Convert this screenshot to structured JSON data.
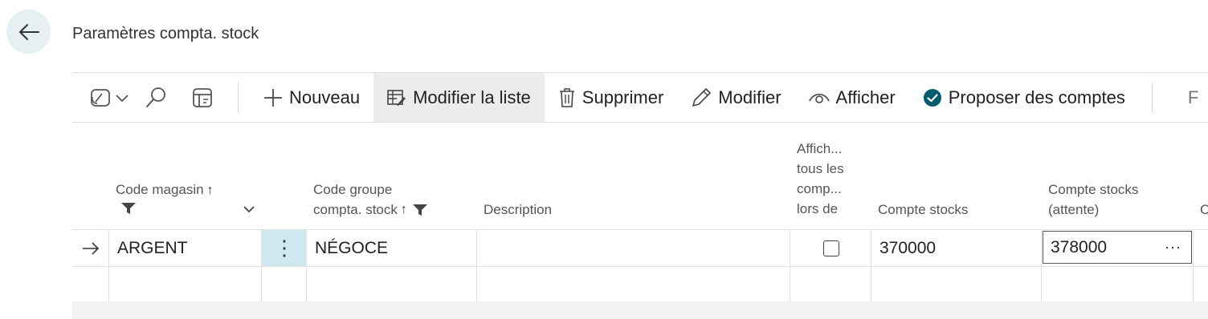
{
  "page": {
    "title": "Paramètres compta. stock"
  },
  "actions": {
    "nouveau": "Nouveau",
    "modifier_liste": "Modifier la liste",
    "supprimer": "Supprimer",
    "modifier": "Modifier",
    "afficher": "Afficher",
    "proposer": "Proposer des comptes"
  },
  "columns": {
    "code_magasin": "Code magasin",
    "code_groupe_line1": "Code groupe",
    "code_groupe_line2": "compta. stock",
    "description": "Description",
    "afficher_line1": "Affich...",
    "afficher_line2": "tous les",
    "afficher_line3": "comp...",
    "afficher_line4": "lors de",
    "compte_stocks": "Compte stocks",
    "compte_attente_line1": "Compte stocks",
    "compte_attente_line2": "(attente)",
    "next_partial": "C"
  },
  "rows": [
    {
      "code_magasin": "ARGENT",
      "code_groupe": "NÉGOCE",
      "description": "",
      "afficher_tous": false,
      "compte_stocks": "370000",
      "compte_attente": "378000"
    }
  ],
  "icons": {
    "back": "arrow-left-icon",
    "copilot": "copilot-icon",
    "search": "search-icon",
    "layout": "layout-icon",
    "add": "plus-icon",
    "edit_list": "edit-list-icon",
    "delete": "trash-icon",
    "edit": "pencil-icon",
    "view": "eye-icon",
    "suggest": "check-circle-icon",
    "sort": "sort-ascending-icon",
    "filter": "filter-icon"
  },
  "colors": {
    "accent_blue": "#005b70",
    "selected_cell": "#cfe8ef",
    "back_bg": "#e6eff2"
  }
}
